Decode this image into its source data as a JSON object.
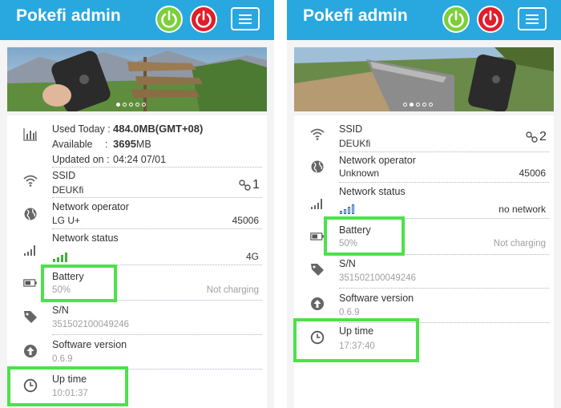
{
  "panels": [
    {
      "app_title": "Pokefi admin",
      "header": {
        "power_on_icon": "power-icon",
        "power_off_icon": "power-icon",
        "menu_icon": "hamburger-menu-icon"
      },
      "usage": {
        "used_today_label": "Used Today :",
        "used_today_value": "484.0MB(GMT+08)",
        "available_label": "Available",
        "available_colon": ":",
        "available_value": "3695",
        "available_unit": "MB",
        "updated_label": "Updated on :",
        "updated_value": "04:24 07/01"
      },
      "ssid": {
        "label": "SSID",
        "value": "DEUKfi",
        "clients": "1"
      },
      "operator": {
        "label": "Network operator",
        "value": "LG U+",
        "code": "45006"
      },
      "network_status": {
        "label": "Network status",
        "value": "4G",
        "signal_level": 4
      },
      "battery": {
        "label": "Battery",
        "value": "50%",
        "status": "Not charging",
        "level": 0.5
      },
      "sn": {
        "label": "S/N",
        "value": "351502100049246"
      },
      "software": {
        "label": "Software version",
        "value": "0.6.9"
      },
      "uptime": {
        "label": "Up time",
        "value": "10:01:37"
      }
    },
    {
      "app_title": "Pokefi admin",
      "header": {
        "power_on_icon": "power-icon",
        "power_off_icon": "power-icon",
        "menu_icon": "hamburger-menu-icon"
      },
      "ssid": {
        "label": "SSID",
        "value": "DEUKfi",
        "clients": "2"
      },
      "operator": {
        "label": "Network operator",
        "value": "Unknown",
        "code": "45006"
      },
      "network_status": {
        "label": "Network status",
        "value": "no network",
        "signal_level": 0
      },
      "battery": {
        "label": "Battery",
        "value": "50%",
        "status": "Not charging",
        "level": 0.5
      },
      "sn": {
        "label": "S/N",
        "value": "351502100049246"
      },
      "software": {
        "label": "Software version",
        "value": "0.6.9"
      },
      "uptime": {
        "label": "Up time",
        "value": "17:37:40"
      }
    }
  ],
  "colors": {
    "header": "#29a7df",
    "power_on": "#7ccf3a",
    "power_off": "#e11d2a",
    "signal": "#3db33a",
    "highlight": "#4ce24a",
    "icon": "#666666"
  }
}
